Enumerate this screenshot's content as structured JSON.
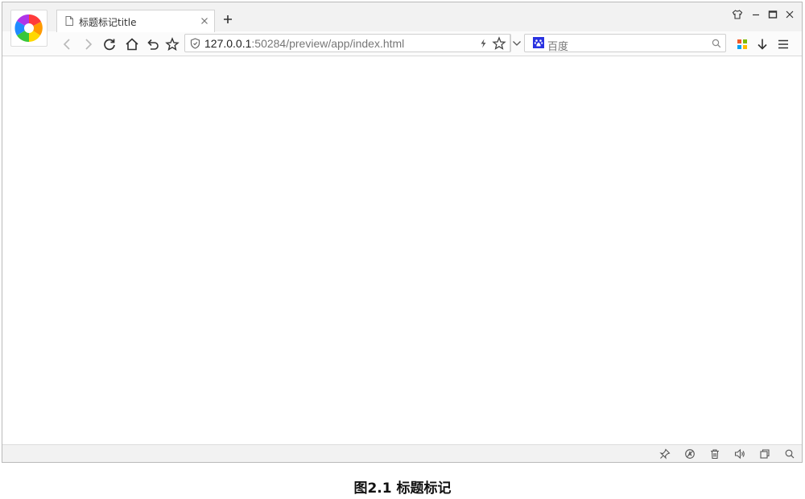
{
  "browser": {
    "tab": {
      "title": "标题标记title"
    },
    "address": {
      "host": "127.0.0.1",
      "rest": ":50284/preview/app/index.html"
    },
    "search": {
      "engine_icon": "baidu-paw-icon",
      "placeholder": "百度"
    }
  },
  "caption": "图2.1  标题标记",
  "colors": {
    "chrome_bg": "#f2f2f2",
    "border": "#b9b9b9",
    "icon": "#333333"
  }
}
